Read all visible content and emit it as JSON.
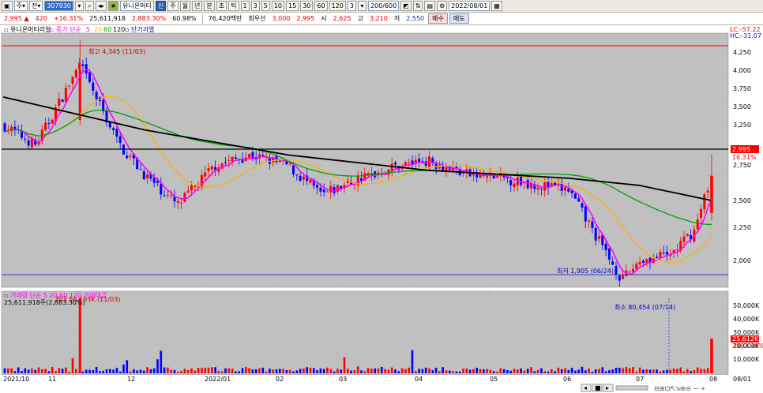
{
  "toolbar1": {
    "period_select": "주",
    "market_select": "전",
    "code_value": "307930",
    "stock_name": "유니온머티",
    "info_badge": "신",
    "period_tabs": [
      "주",
      "월",
      "년",
      "분",
      "초",
      "틱"
    ],
    "intervals": [
      "1",
      "3",
      "5",
      "10",
      "15",
      "30",
      "60",
      "120"
    ],
    "custom_interval": "3",
    "range_value": "200/600",
    "date_value": "2022/08/01"
  },
  "quote": {
    "price": "2,995",
    "change": "420",
    "change_pct": "+16.31%",
    "volume": "25,611,918",
    "volume_ratio": "2,883.30%",
    "turnover": "60.98%",
    "trade_amount": "76,420백만",
    "prefix_label": "최우선",
    "ask": "3,000",
    "bid": "2,995",
    "open_label": "시",
    "open": "2,625",
    "high_label": "고",
    "high": "3,210",
    "low_label": "저",
    "low": "2,550",
    "buy_label": "매수",
    "sell_label": "매도"
  },
  "price_panel": {
    "legend_name": "유니온머티리얼",
    "legend_ma": "종가 단순",
    "ma_periods": [
      "5",
      "20",
      "60",
      "120"
    ],
    "legend_extra": "단기과열",
    "right_top_lc": "LC:-57.22",
    "right_top_hc": "HC:-31.07",
    "current_price_tag": "2,995",
    "current_pct_tag": "16.31%",
    "max_label": "최고 4,345 (11/03)",
    "min_label": "최저 1,905 (06/24)",
    "y_ticks": [
      "4,250",
      "4,000",
      "3,750",
      "3,500",
      "3,250",
      "3,000",
      "2,750",
      "2,500",
      "2,250",
      "2,000"
    ]
  },
  "volume_panel": {
    "legend": "거래량 단순 5 20 60 120 거래대금",
    "value_text": "25,611,918주(2,883.30%)",
    "max_label": "최대 56,193K (11/03)",
    "min_label": "최소 80,454 (07/14)",
    "y_ticks": [
      "50,000K",
      "40,000K",
      "30,000K",
      "20,000K",
      "10,000K"
    ],
    "current_tag": "25,612K",
    "current_pct_tag": "2883.30%"
  },
  "x_axis": {
    "labels": [
      "2021/10",
      "11",
      "12",
      "2022/01",
      "02",
      "03",
      "04",
      "05",
      "06",
      "07",
      "08",
      "08/01"
    ]
  },
  "colors": {
    "plot_bg": "#c0c0c0",
    "up": "#ff0000",
    "down": "#0000ff",
    "ma5": "#ff00ff",
    "ma20": "#ffb000",
    "ma60": "#00a000",
    "ma120": "#000000"
  },
  "chart_data": {
    "type": "candlestick",
    "y_range": [
      1900,
      4400
    ],
    "series_points": [
      [
        "2021-10-01",
        3500
      ],
      [
        "2021-10-15",
        3300
      ],
      [
        "2021-11-03",
        4100
      ],
      [
        "2021-11-20",
        3300
      ],
      [
        "2021-12-01",
        3000
      ],
      [
        "2021-12-15",
        2700
      ],
      [
        "2021-12-31",
        3100
      ],
      [
        "2022-01-15",
        3200
      ],
      [
        "2022-01-31",
        3100
      ],
      [
        "2022-02-15",
        2800
      ],
      [
        "2022-03-01",
        2950
      ],
      [
        "2022-03-20",
        3100
      ],
      [
        "2022-04-01",
        3150
      ],
      [
        "2022-04-20",
        3000
      ],
      [
        "2022-05-01",
        2980
      ],
      [
        "2022-05-20",
        2900
      ],
      [
        "2022-06-01",
        2850
      ],
      [
        "2022-06-24",
        1950
      ],
      [
        "2022-07-01",
        2150
      ],
      [
        "2022-07-14",
        2200
      ],
      [
        "2022-07-25",
        2450
      ],
      [
        "2022-08-01",
        2995
      ]
    ],
    "ma120_points": [
      [
        "2021-10-01",
        3780
      ],
      [
        "2021-12-01",
        3450
      ],
      [
        "2022-02-01",
        3200
      ],
      [
        "2022-04-01",
        3050
      ],
      [
        "2022-06-01",
        2970
      ],
      [
        "2022-07-01",
        2900
      ],
      [
        "2022-08-01",
        2750
      ]
    ]
  }
}
